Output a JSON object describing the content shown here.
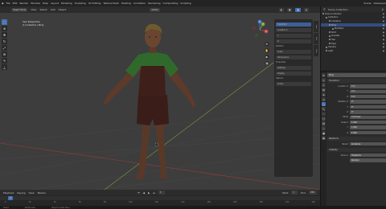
{
  "topbar": {
    "menus": [
      "File",
      "Edit",
      "Render",
      "Window",
      "Help"
    ],
    "workspaces": [
      "Layout",
      "Modeling",
      "Sculpting",
      "UV Editing",
      "Texture Paint",
      "Shading",
      "Animation",
      "Rendering",
      "Compositing",
      "Scripting"
    ],
    "scene_label": "Scene",
    "view_layer_label": "ViewLayer"
  },
  "viewport": {
    "mode": "Object Mode",
    "view_menus": [
      "View",
      "Select",
      "Add",
      "Object"
    ],
    "shading": "Global",
    "info_line1": "User Perspective",
    "info_line2": "(1) Collection | Body",
    "gizmo_axes": [
      "X",
      "Y",
      "Z"
    ]
  },
  "npanel": {
    "tabs": [
      "Item",
      "Tool",
      "View"
    ],
    "rows": [
      "Transform",
      "Location X",
      "Y",
      "Z",
      "Rotation",
      "Scale",
      "Dimensions",
      "Properties",
      "Settings",
      "Display",
      "Options",
      "Active"
    ]
  },
  "timeline": {
    "menus": [
      "Playback",
      "Keying",
      "View",
      "Marker"
    ],
    "current_frame": "1",
    "start_label": "Start",
    "start": "1",
    "end_label": "End",
    "end": "250",
    "ticks": [
      "0",
      "20",
      "40",
      "60",
      "80",
      "100",
      "120",
      "140",
      "160",
      "180",
      "200",
      "220",
      "240"
    ]
  },
  "outliner": {
    "title": "Scene Collection",
    "items": [
      {
        "label": "Scene Collection",
        "indent": 0,
        "selected": false
      },
      {
        "label": "Collection",
        "indent": 1,
        "selected": false
      },
      {
        "label": "Armature",
        "indent": 2,
        "selected": false
      },
      {
        "label": "Body",
        "indent": 2,
        "selected": true
      },
      {
        "label": "Modifiers",
        "indent": 3,
        "selected": false
      },
      {
        "label": "Shirt",
        "indent": 2,
        "selected": false
      },
      {
        "label": "Overalls",
        "indent": 2,
        "selected": false
      },
      {
        "label": "Hair",
        "indent": 2,
        "selected": false
      },
      {
        "label": "Eyes",
        "indent": 2,
        "selected": false
      },
      {
        "label": "Camera",
        "indent": 1,
        "selected": false
      },
      {
        "label": "Light",
        "indent": 1,
        "selected": false
      }
    ]
  },
  "properties": {
    "object_name": "Body",
    "sections": [
      {
        "title": "Transform",
        "rows": [
          {
            "k": "Location X",
            "v": "0 m"
          },
          {
            "k": "Y",
            "v": "0 m"
          },
          {
            "k": "Z",
            "v": "0 m"
          },
          {
            "k": "Rotation X",
            "v": "0°"
          },
          {
            "k": "Y",
            "v": "0°"
          },
          {
            "k": "Z",
            "v": "0°"
          },
          {
            "k": "Mode",
            "v": "XYZ Euler"
          },
          {
            "k": "Scale X",
            "v": "1.000"
          },
          {
            "k": "Y",
            "v": "1.000"
          },
          {
            "k": "Z",
            "v": "1.000"
          }
        ]
      },
      {
        "title": "Relations",
        "rows": [
          {
            "k": "Parent",
            "v": "Armature"
          }
        ]
      },
      {
        "title": "Visibility",
        "rows": [
          {
            "k": "Show In",
            "v": "Viewports"
          },
          {
            "k": "",
            "v": "Renders"
          }
        ]
      }
    ]
  },
  "statusbar": {
    "left": "Select",
    "middle": "Rotate View",
    "right": "Object Context Menu"
  }
}
